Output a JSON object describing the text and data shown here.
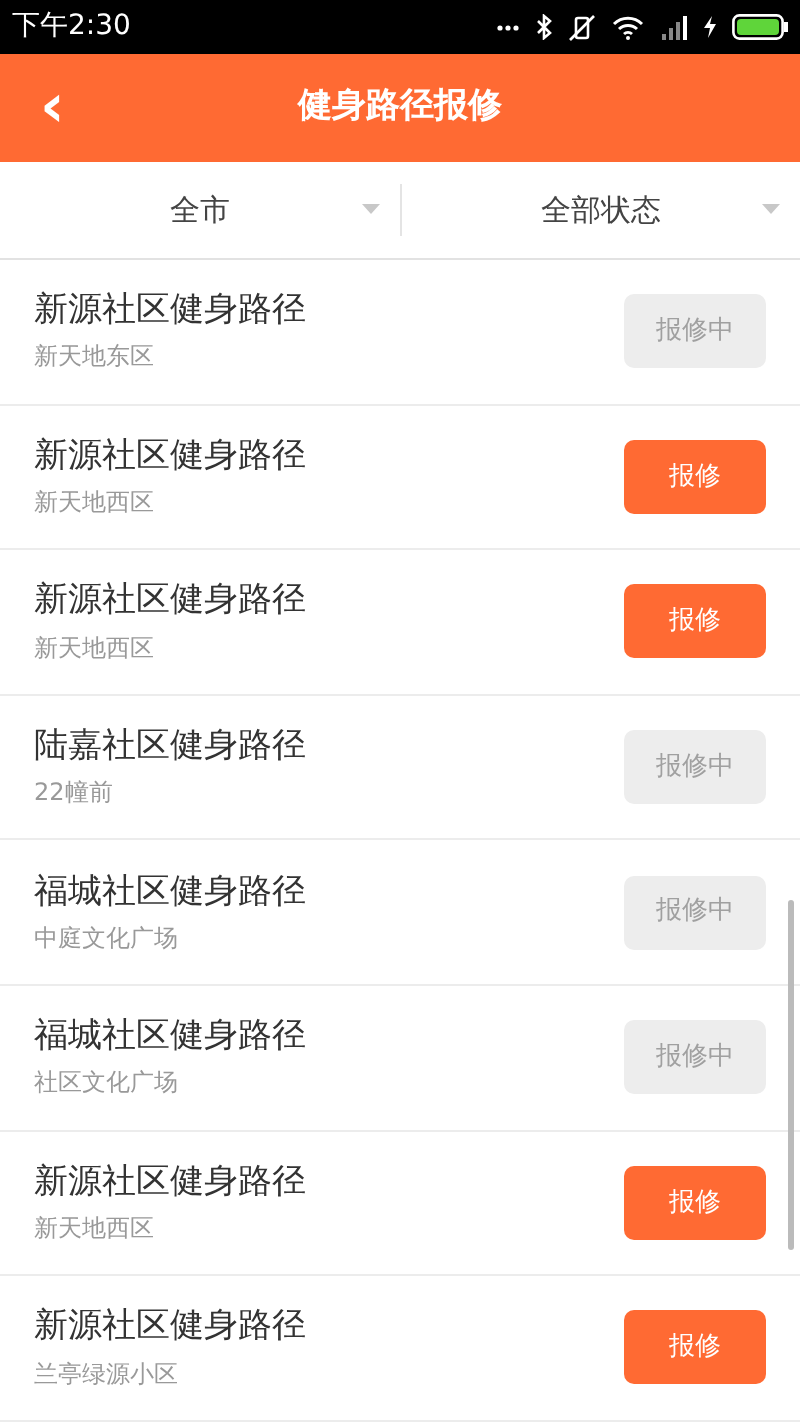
{
  "status_bar": {
    "time": "下午2:30"
  },
  "header": {
    "back": "‹",
    "title": "健身路径报修"
  },
  "filters": [
    {
      "label": "全市"
    },
    {
      "label": "全部状态"
    }
  ],
  "items": [
    {
      "name": "新源社区健身路径",
      "location": "新天地东区",
      "action": "报修中",
      "disabled": true
    },
    {
      "name": "新源社区健身路径",
      "location": "新天地西区",
      "action": "报修",
      "disabled": false
    },
    {
      "name": "新源社区健身路径",
      "location": "新天地西区",
      "action": "报修",
      "disabled": false
    },
    {
      "name": "陆嘉社区健身路径",
      "location": "22幢前",
      "action": "报修中",
      "disabled": true
    },
    {
      "name": "福城社区健身路径",
      "location": "中庭文化广场",
      "action": "报修中",
      "disabled": true
    },
    {
      "name": "福城社区健身路径",
      "location": "社区文化广场",
      "action": "报修中",
      "disabled": true
    },
    {
      "name": "新源社区健身路径",
      "location": "新天地西区",
      "action": "报修",
      "disabled": false
    },
    {
      "name": "新源社区健身路径",
      "location": "兰亭绿源小区",
      "action": "报修",
      "disabled": false
    }
  ]
}
